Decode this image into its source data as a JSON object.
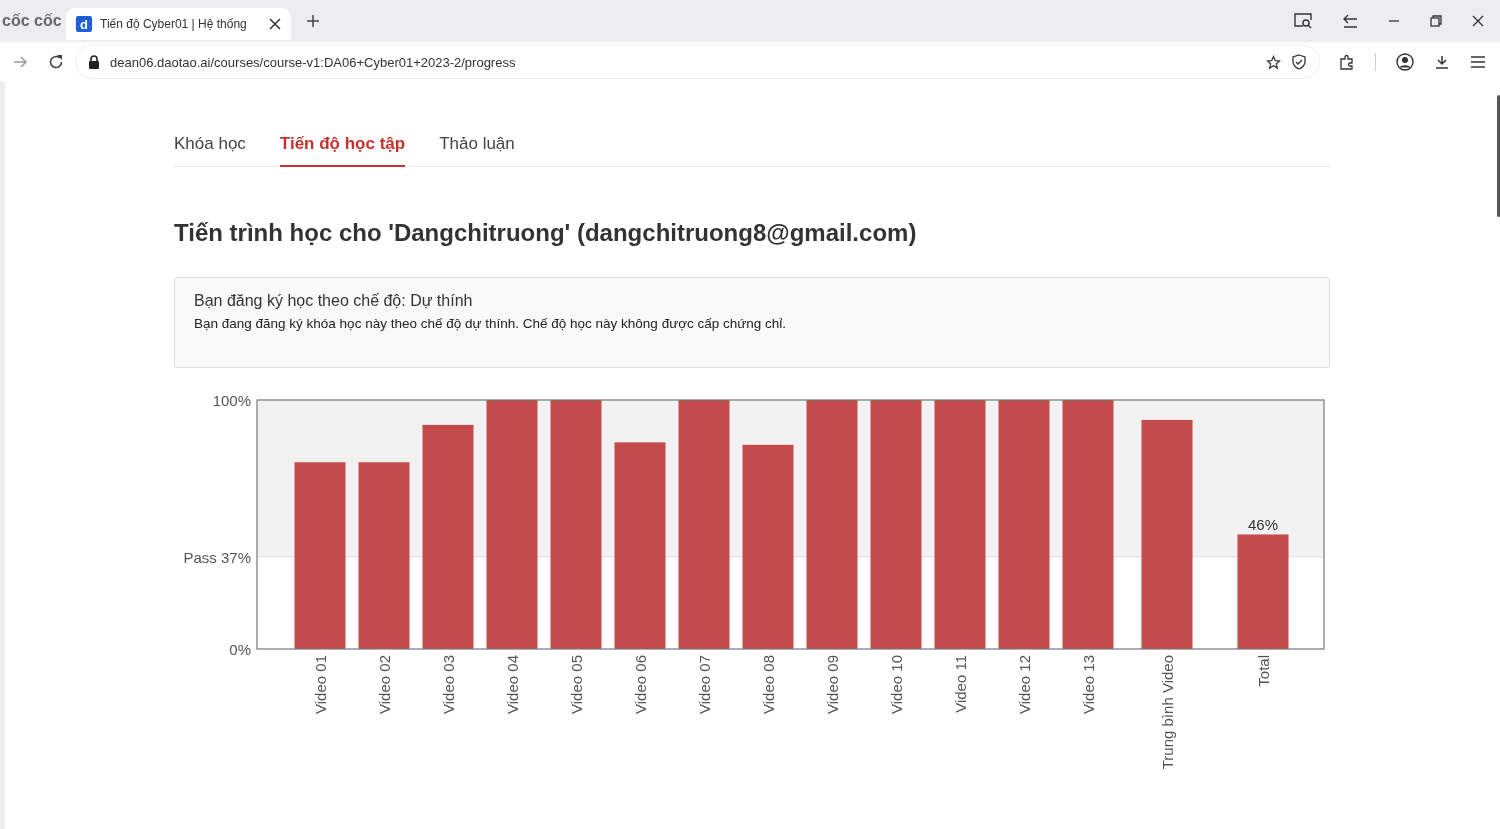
{
  "browser": {
    "logo": "cốc cốc",
    "tab": {
      "favicon_letter": "d",
      "title": "Tiến độ Cyber01 | Hệ thống"
    },
    "url": "dean06.daotao.ai/courses/course-v1:DA06+Cyber01+2023-2/progress"
  },
  "nav_tabs": [
    {
      "label": "Khóa học",
      "selected": false
    },
    {
      "label": "Tiến độ học tập",
      "selected": true
    },
    {
      "label": "Thảo luận",
      "selected": false
    }
  ],
  "heading": "Tiến trình học cho 'Dangchitruong' (dangchitruong8@gmail.com)",
  "notice": {
    "title": "Bạn đăng ký học theo chế độ: Dự thính",
    "text": "Bạn đang đăng ký khóa học này theo chế độ dự thính. Chế độ học này không được cấp chứng chỉ."
  },
  "progress_chart": {
    "chart_data": {
      "type": "bar",
      "categories": [
        "Video 01",
        "Video 02",
        "Video 03",
        "Video 04",
        "Video 05",
        "Video 06",
        "Video 07",
        "Video 08",
        "Video 09",
        "Video 10",
        "Video 11",
        "Video 12",
        "Video 13",
        "Trung bình Video",
        "Total"
      ],
      "series": [
        {
          "color": "#c44b4b",
          "values": [
            0.75,
            0.75,
            0.9,
            1,
            1,
            0.83,
            1,
            0.82,
            1,
            1,
            1,
            1,
            1,
            0.92,
            0.46
          ]
        }
      ],
      "ylim": [
        0,
        1
      ],
      "yticks": [
        {
          "value": 0,
          "label": "0%"
        },
        {
          "value": 0.37,
          "label": "Pass 37%"
        },
        {
          "value": 1,
          "label": "100%"
        }
      ],
      "bands": [
        {
          "axis": "y",
          "from": 0.37,
          "to": 1,
          "color": "#f2f2f2"
        }
      ],
      "annotations": [
        "46%"
      ]
    }
  }
}
